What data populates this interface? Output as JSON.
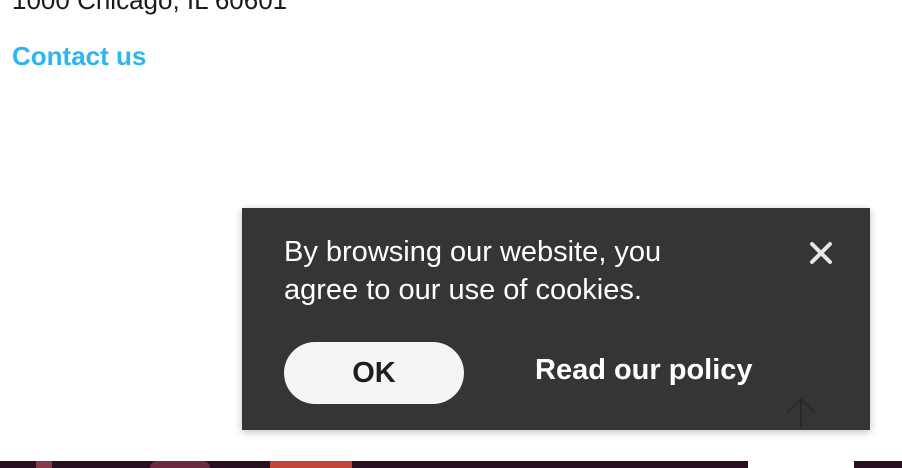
{
  "footer": {
    "address_line": "1000 Chicago, IL 60601",
    "contact_link": "Contact us"
  },
  "cookie_banner": {
    "message": "By browsing our website, you agree to our use of cookies.",
    "ok_label": "OK",
    "policy_label": "Read our policy",
    "close_icon": "close-icon"
  },
  "back_to_top": {
    "icon": "arrow-up-icon"
  },
  "colors": {
    "link_accent": "#2bb6ee",
    "banner_background": "#28282a",
    "ok_button_background": "#f4f5f7"
  }
}
